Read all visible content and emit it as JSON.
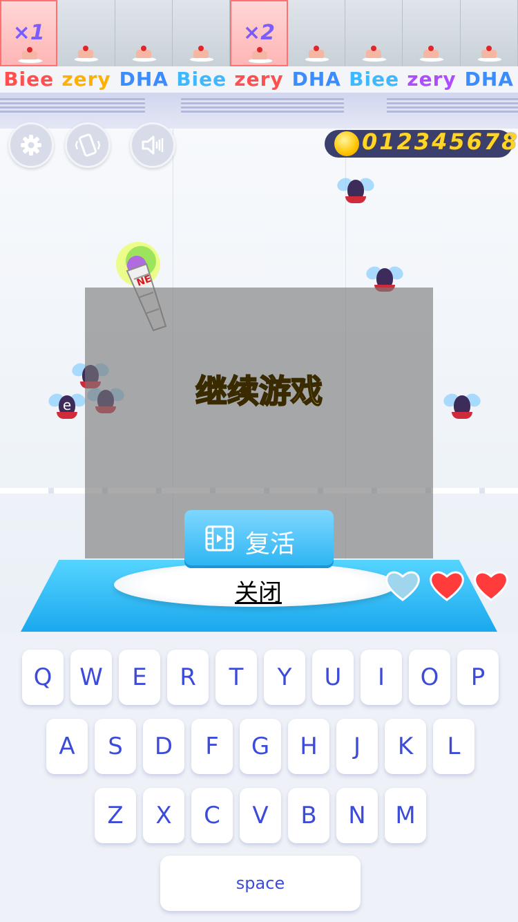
{
  "top_strip": {
    "cells": [
      {
        "multiplier": "×1",
        "highlight": true
      },
      {
        "multiplier": "",
        "highlight": false
      },
      {
        "multiplier": "",
        "highlight": false
      },
      {
        "multiplier": "",
        "highlight": false
      },
      {
        "multiplier": "×2",
        "highlight": true
      },
      {
        "multiplier": "",
        "highlight": false
      },
      {
        "multiplier": "",
        "highlight": false
      },
      {
        "multiplier": "",
        "highlight": false
      },
      {
        "multiplier": "",
        "highlight": false
      }
    ],
    "brands": [
      {
        "text": "Biee",
        "color": "#ff4f4f"
      },
      {
        "text": "zery",
        "color": "#ffb000"
      },
      {
        "text": "DHA",
        "color": "#3a8cff"
      },
      {
        "text": "Biee",
        "color": "#3fb8ff"
      },
      {
        "text": "zery",
        "color": "#ff4f4f"
      },
      {
        "text": "DHA",
        "color": "#3a8cff"
      },
      {
        "text": "Biee",
        "color": "#3fb8ff"
      },
      {
        "text": "zery",
        "color": "#b04cff"
      },
      {
        "text": "DHA",
        "color": "#3a8cff"
      }
    ]
  },
  "controls": {
    "settings_icon": "gear-icon",
    "phone_icon": "phone-shake-icon",
    "sound_icon": "speaker-icon"
  },
  "coins": {
    "value": "012345678",
    "icon": "gold-coin-icon"
  },
  "flies": [
    {
      "letter": ""
    },
    {
      "letter": ""
    },
    {
      "letter": ""
    },
    {
      "letter": ""
    },
    {
      "letter": "e"
    },
    {
      "letter": ""
    }
  ],
  "dialog": {
    "continue_label": "继续游戏",
    "revive_label": "复活",
    "revive_icon": "video-film-icon",
    "close_label": "关闭"
  },
  "lives": {
    "total": 3,
    "empty": 1,
    "full_color": "#ff3b3b",
    "empty_color": "#9fd6ee"
  },
  "keyboard": {
    "row1": [
      "Q",
      "W",
      "E",
      "R",
      "T",
      "Y",
      "U",
      "I",
      "O",
      "P"
    ],
    "row2": [
      "A",
      "S",
      "D",
      "F",
      "G",
      "H",
      "J",
      "K",
      "L"
    ],
    "row3": [
      "Z",
      "X",
      "C",
      "V",
      "B",
      "N",
      "M"
    ],
    "space_label": "space"
  }
}
